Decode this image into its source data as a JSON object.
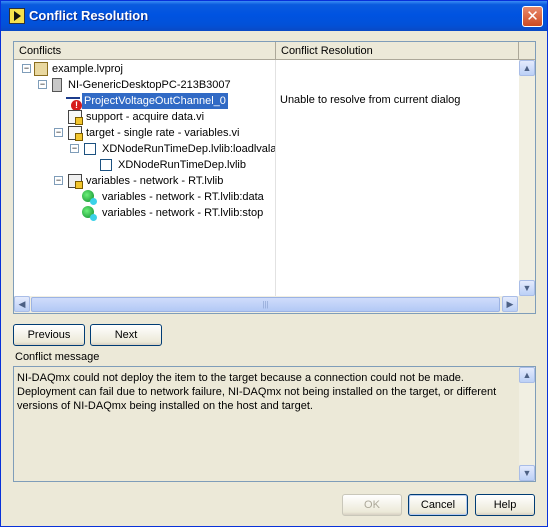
{
  "window": {
    "title": "Conflict Resolution"
  },
  "table": {
    "headers": {
      "conflicts": "Conflicts",
      "resolution": "Conflict Resolution"
    },
    "tree": [
      {
        "label": "example.lvproj"
      },
      {
        "label": "NI-GenericDesktopPC-213B3007"
      },
      {
        "label": "ProjectVoltageOutChannel_0",
        "selected": true,
        "resolution": "Unable to resolve from current dialog"
      },
      {
        "label": "support - acquire data.vi"
      },
      {
        "label": "target - single rate - variables.vi"
      },
      {
        "label": "XDNodeRunTimeDep.lvlib:loadlvalarm"
      },
      {
        "label": "XDNodeRunTimeDep.lvlib"
      },
      {
        "label": "variables - network - RT.lvlib"
      },
      {
        "label": "variables - network - RT.lvlib:data"
      },
      {
        "label": "variables - network - RT.lvlib:stop"
      }
    ]
  },
  "nav": {
    "previous": "Previous",
    "next": "Next"
  },
  "message": {
    "label": "Conflict message",
    "text": "NI-DAQmx could not deploy the item to the target because a connection could not be made. Deployment can fail due to network failure, NI-DAQmx not being installed on the target, or different versions of NI-DAQmx being installed on the host and target."
  },
  "footer": {
    "ok": "OK",
    "cancel": "Cancel",
    "help": "Help"
  }
}
